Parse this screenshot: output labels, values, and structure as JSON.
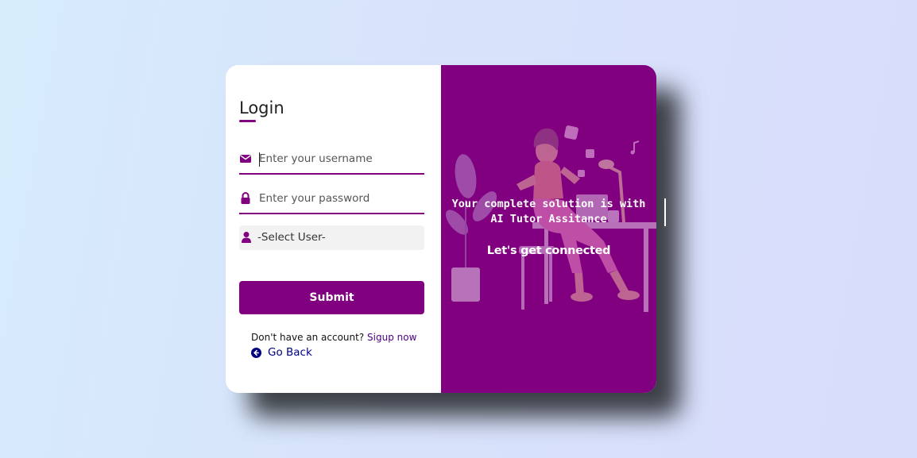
{
  "login": {
    "title": "Login",
    "username_placeholder": "Enter your username",
    "password_placeholder": "Enter your password",
    "user_select_value": "-Select User-",
    "submit_label": "Submit",
    "signup_prompt": "Don't have an account?",
    "signup_link": "Sigup now",
    "go_back_label": "Go Back"
  },
  "promo": {
    "tagline": "Your complete solution is with\nAI Tutor Assitance",
    "subtitle": "Let's get connected"
  },
  "colors": {
    "accent": "#800080",
    "link": "#4b0082",
    "goback": "#000080"
  },
  "icons": {
    "username": "envelope-icon",
    "password": "lock-icon",
    "user_type": "user-icon",
    "go_back": "arrow-circle-left-icon"
  }
}
